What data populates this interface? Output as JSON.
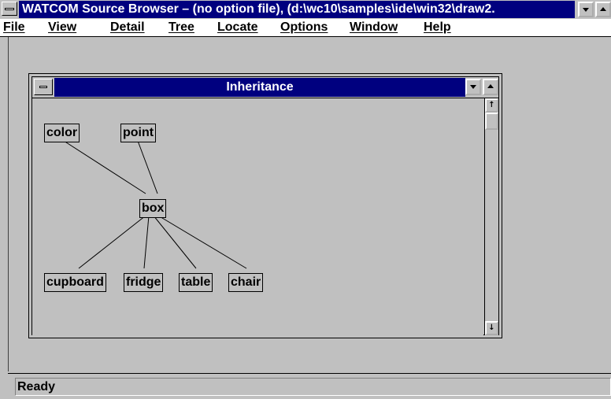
{
  "window": {
    "title": "WATCOM Source Browser – (no option file), (d:\\wc10\\samples\\ide\\win32\\draw2."
  },
  "menu": {
    "items": [
      {
        "label": "File"
      },
      {
        "label": "View"
      },
      {
        "label": "Detail"
      },
      {
        "label": "Tree"
      },
      {
        "label": "Locate"
      },
      {
        "label": "Options"
      },
      {
        "label": "Window"
      },
      {
        "label": "Help"
      }
    ]
  },
  "child_window": {
    "title": "Inheritance"
  },
  "graph": {
    "nodes": {
      "color": "color",
      "point": "point",
      "box": "box",
      "cupboard": "cupboard",
      "fridge": "fridge",
      "table": "table",
      "chair": "chair"
    },
    "edges": [
      [
        "color",
        "box"
      ],
      [
        "point",
        "box"
      ],
      [
        "box",
        "cupboard"
      ],
      [
        "box",
        "fridge"
      ],
      [
        "box",
        "table"
      ],
      [
        "box",
        "chair"
      ]
    ]
  },
  "statusbar": {
    "text": "Ready"
  },
  "colors": {
    "active_title": "#00007f",
    "face": "#c0c0c0"
  }
}
